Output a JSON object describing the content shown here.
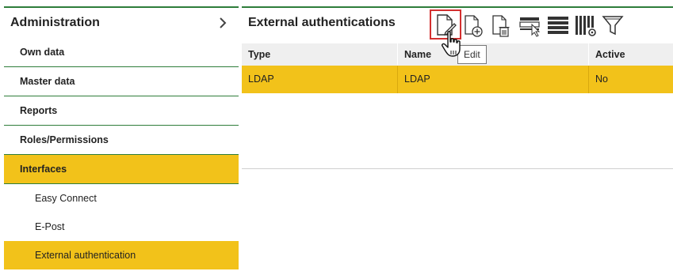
{
  "sidebar": {
    "title": "Administration",
    "items": [
      {
        "label": "Own data"
      },
      {
        "label": "Master data"
      },
      {
        "label": "Reports"
      },
      {
        "label": "Roles/Permissions"
      },
      {
        "label": "Interfaces"
      }
    ],
    "sub_items": [
      {
        "label": "Easy Connect"
      },
      {
        "label": "E-Post"
      },
      {
        "label": "External authentication"
      }
    ]
  },
  "main": {
    "title": "External authentications",
    "toolbar": [
      "edit-document-icon",
      "add-document-icon",
      "delete-document-icon",
      "select-row-icon",
      "list-view-icon",
      "column-settings-icon",
      "filter-icon"
    ],
    "tooltip": "Edit",
    "table": {
      "columns": [
        "Type",
        "Name",
        "Active"
      ],
      "rows": [
        [
          "LDAP",
          "LDAP",
          "No"
        ]
      ]
    }
  },
  "colors": {
    "accent": "#f2c21a",
    "border": "#2e7d3a",
    "focus": "#d32f2f"
  }
}
